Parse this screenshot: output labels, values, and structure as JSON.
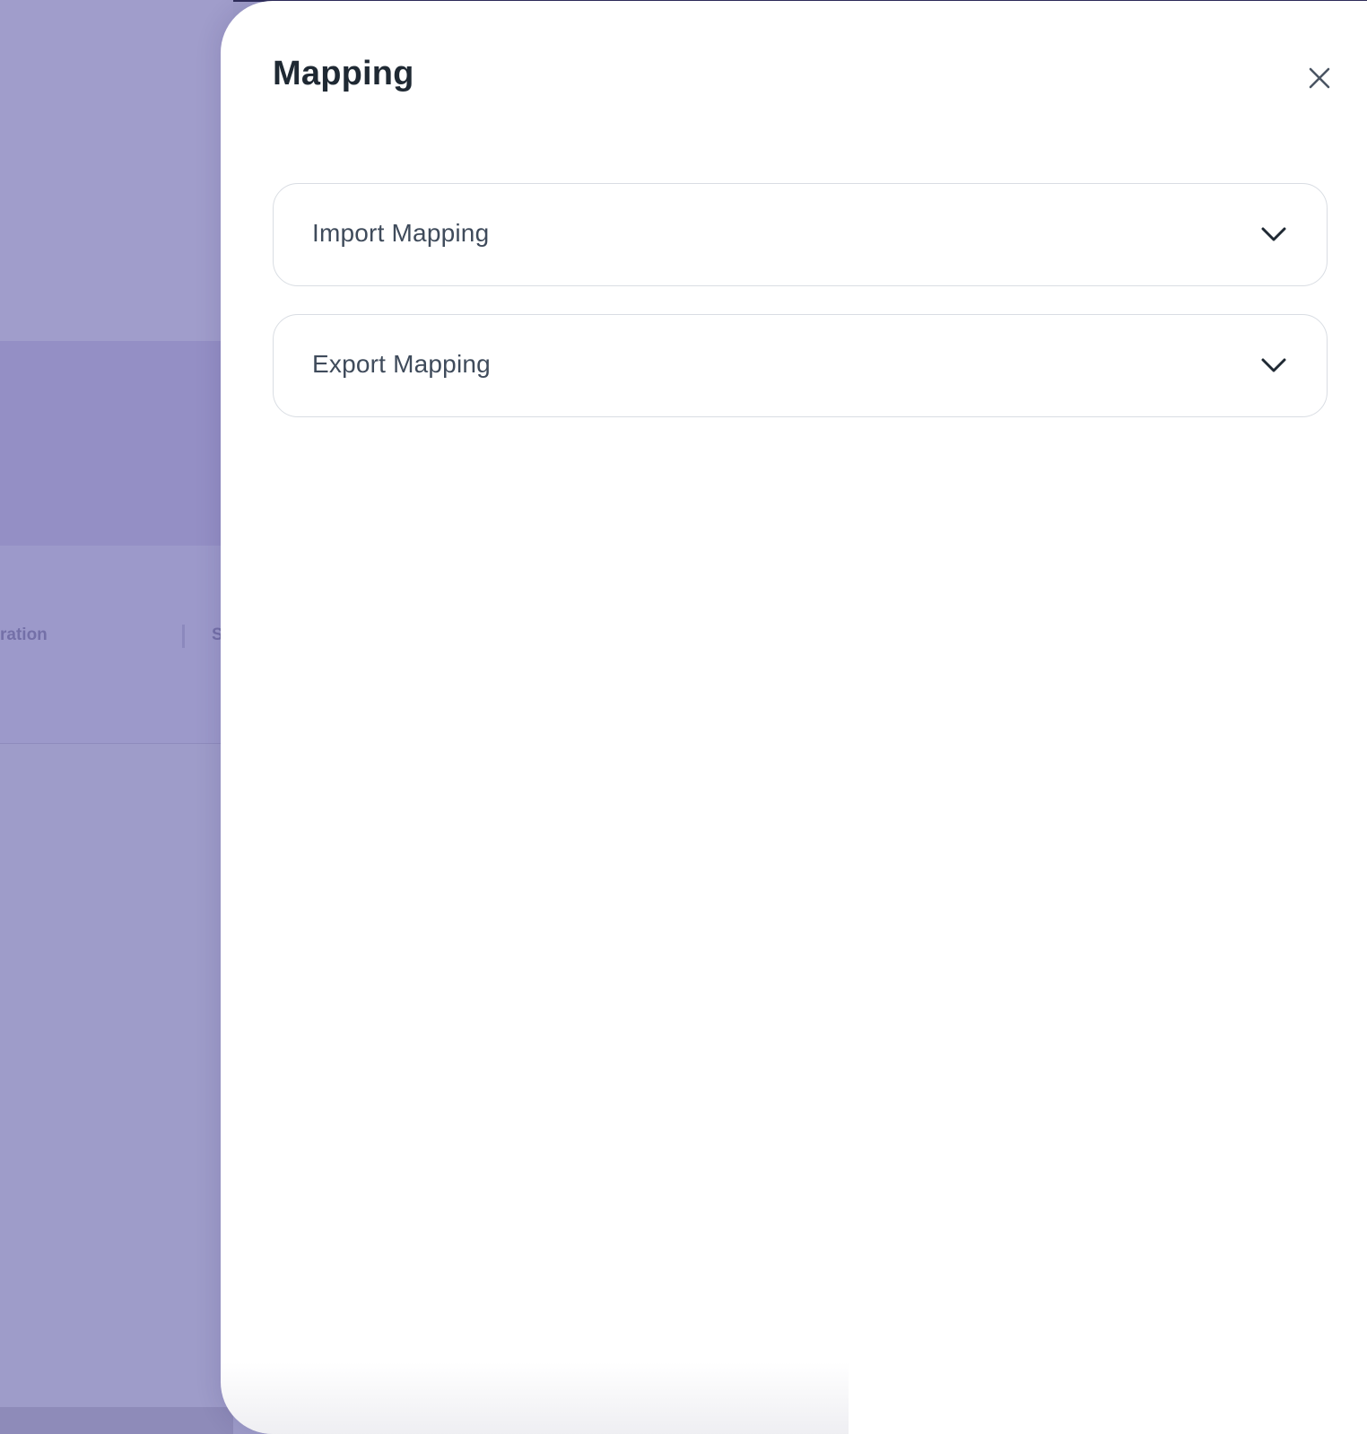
{
  "background": {
    "column_1_label": "ration",
    "column_2_label": "S"
  },
  "drawer": {
    "title": "Mapping",
    "close_icon": "close-icon",
    "sections": [
      {
        "label": "Import Mapping",
        "icon": "chevron-down-icon",
        "expanded": false
      },
      {
        "label": "Export Mapping",
        "icon": "chevron-down-icon",
        "expanded": false
      }
    ]
  },
  "colors": {
    "overlay": "#9e9cc9",
    "title_text": "#1f2933",
    "section_text": "#3f4b5b",
    "border": "#d9dde3"
  }
}
